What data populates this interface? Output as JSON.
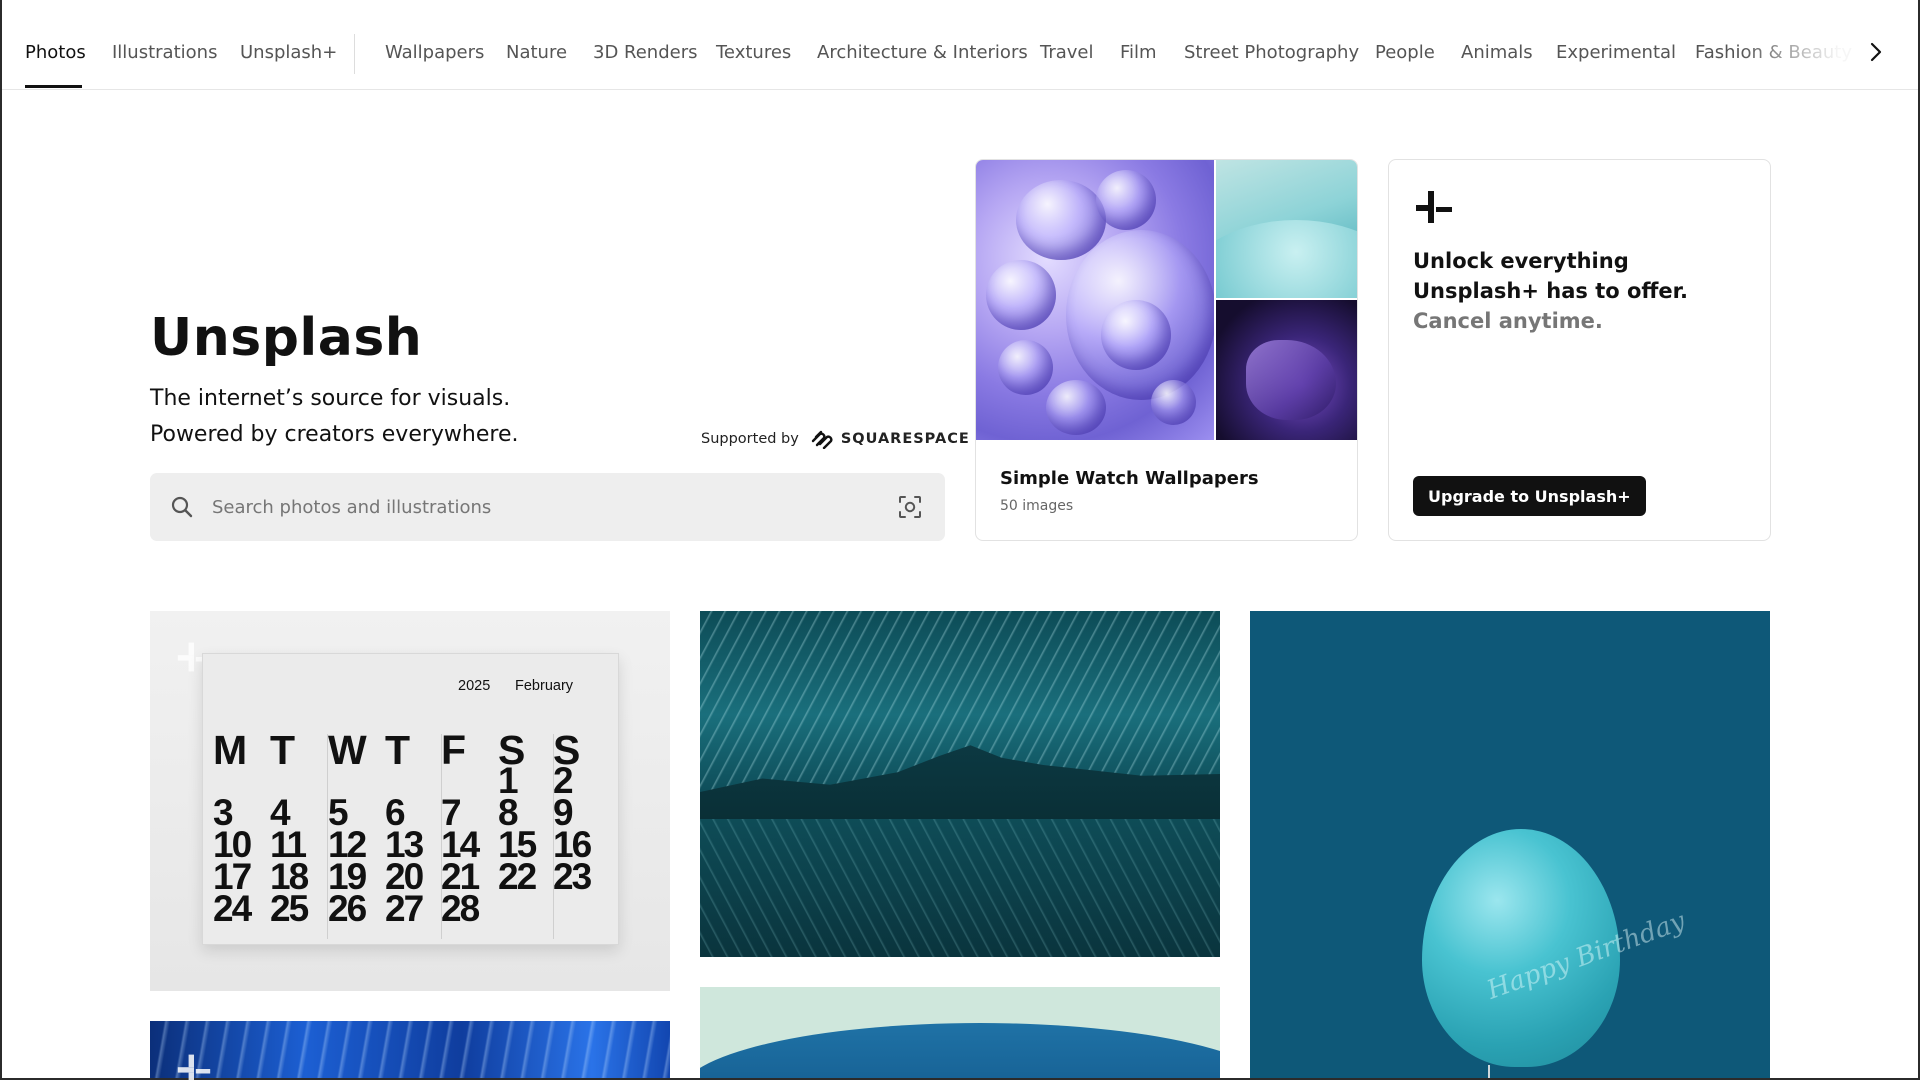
{
  "nav": {
    "items": [
      {
        "label": "Photos"
      },
      {
        "label": "Illustrations"
      },
      {
        "label": "Unsplash+"
      },
      {
        "label": "Wallpapers"
      },
      {
        "label": "Nature"
      },
      {
        "label": "3D Renders"
      },
      {
        "label": "Textures"
      },
      {
        "label": "Architecture & Interiors"
      },
      {
        "label": "Travel"
      },
      {
        "label": "Film"
      },
      {
        "label": "Street Photography"
      },
      {
        "label": "People"
      },
      {
        "label": "Animals"
      },
      {
        "label": "Experimental"
      },
      {
        "label": "Fashion & Beauty"
      }
    ],
    "active": "Photos",
    "next_icon": "chevron-right-icon"
  },
  "hero": {
    "title": "Unsplash",
    "line1": "The internet’s source for visuals.",
    "line2": "Powered by creators everywhere.",
    "supported_by": "Supported by",
    "sponsor": "SQUARESPACE"
  },
  "search": {
    "placeholder": "Search photos and illustrations",
    "value": "",
    "icon": "search-icon",
    "visual_search_icon": "visual-search-icon"
  },
  "collection": {
    "title": "Simple Watch Wallpapers",
    "count": "50 images"
  },
  "plus_card": {
    "headline": "Unlock everything Unsplash+ has to offer.",
    "subline": "Cancel anytime.",
    "button": "Upgrade to Unsplash+"
  },
  "calendar": {
    "year": "2025",
    "month": "February",
    "days": [
      "M",
      "T",
      "W",
      "T",
      "F",
      "S",
      "S"
    ],
    "weeks": [
      [
        "",
        "",
        "",
        "",
        "",
        "1",
        "2"
      ],
      [
        "3",
        "4",
        "5",
        "6",
        "7",
        "8",
        "9"
      ],
      [
        "10",
        "11",
        "12",
        "13",
        "14",
        "15",
        "16"
      ],
      [
        "17",
        "18",
        "19",
        "20",
        "21",
        "22",
        "23"
      ],
      [
        "24",
        "25",
        "26",
        "27",
        "28",
        "",
        ""
      ]
    ]
  },
  "balloon": {
    "text": "Happy Birthday"
  },
  "colors": {
    "text": "#111111",
    "muted": "#767676",
    "search_bg": "#eeeeee",
    "button_bg": "#111111"
  }
}
